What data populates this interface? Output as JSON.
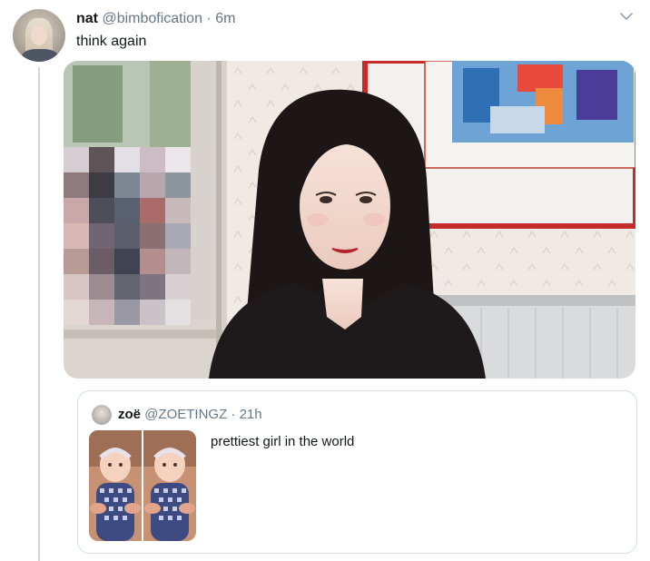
{
  "tweet": {
    "display_name": "nat",
    "handle": "@bimbofication",
    "separator": " · ",
    "time": "6m",
    "text": "think again",
    "avatar_icon": "profile-photo",
    "menu_icon": "chevron-down-icon"
  },
  "quoted_tweet": {
    "display_name": "zoë",
    "handle": "@ZOETINGZ",
    "separator": " · ",
    "time": "21h",
    "text": "prettiest girl in the world",
    "avatar_icon": "profile-photo"
  },
  "colors": {
    "primary_text": "#14171a",
    "secondary_text": "#657786",
    "border": "#d6dde3",
    "thread_line": "#cfd7dd"
  }
}
